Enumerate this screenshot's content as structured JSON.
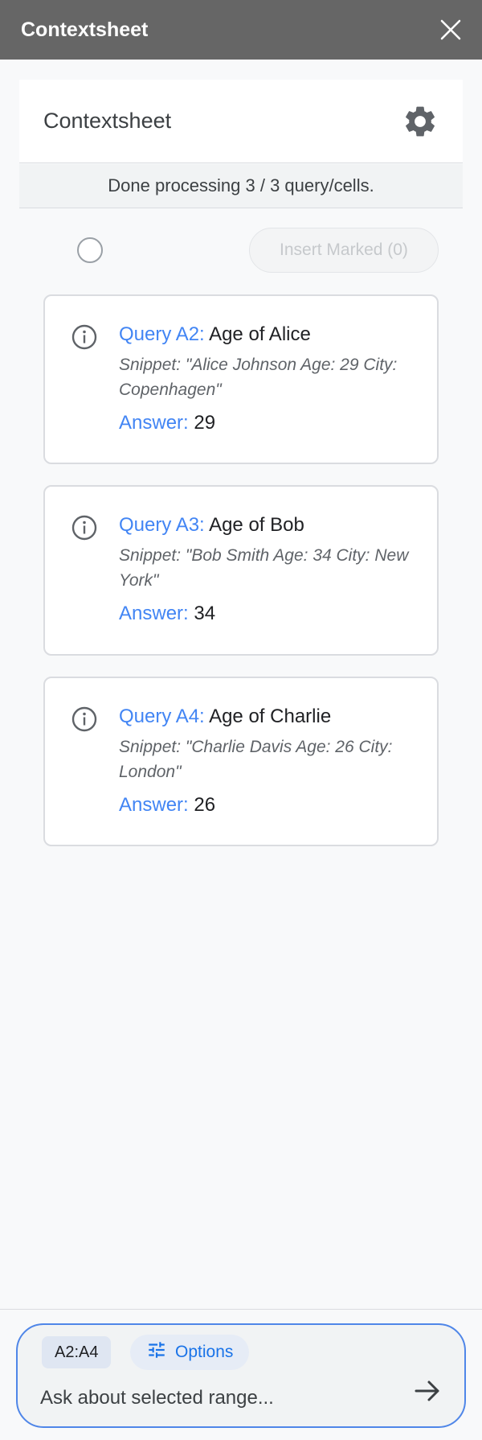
{
  "titlebar": {
    "title": "Contextsheet"
  },
  "header": {
    "title": "Contextsheet"
  },
  "status": {
    "text": "Done processing 3 / 3 query/cells."
  },
  "actions": {
    "insert_label": "Insert Marked (0)"
  },
  "results": [
    {
      "query_label": "Query A2:",
      "query_text": "Age of Alice",
      "snippet": "Snippet: \"Alice Johnson Age: 29 City: Copenhagen\"",
      "answer_label": "Answer:",
      "answer_value": "29"
    },
    {
      "query_label": "Query A3:",
      "query_text": "Age of Bob",
      "snippet": "Snippet: \"Bob Smith Age: 34 City: New York\"",
      "answer_label": "Answer:",
      "answer_value": "34"
    },
    {
      "query_label": "Query A4:",
      "query_text": "Age of Charlie",
      "snippet": "Snippet: \"Charlie Davis Age: 26 City: London\"",
      "answer_label": "Answer:",
      "answer_value": "26"
    }
  ],
  "composer": {
    "range_chip": "A2:A4",
    "options_label": "Options",
    "placeholder": "Ask about selected range..."
  },
  "colors": {
    "accent": "#4285f4",
    "titlebar": "#666666",
    "input_border": "#4f86e8"
  }
}
